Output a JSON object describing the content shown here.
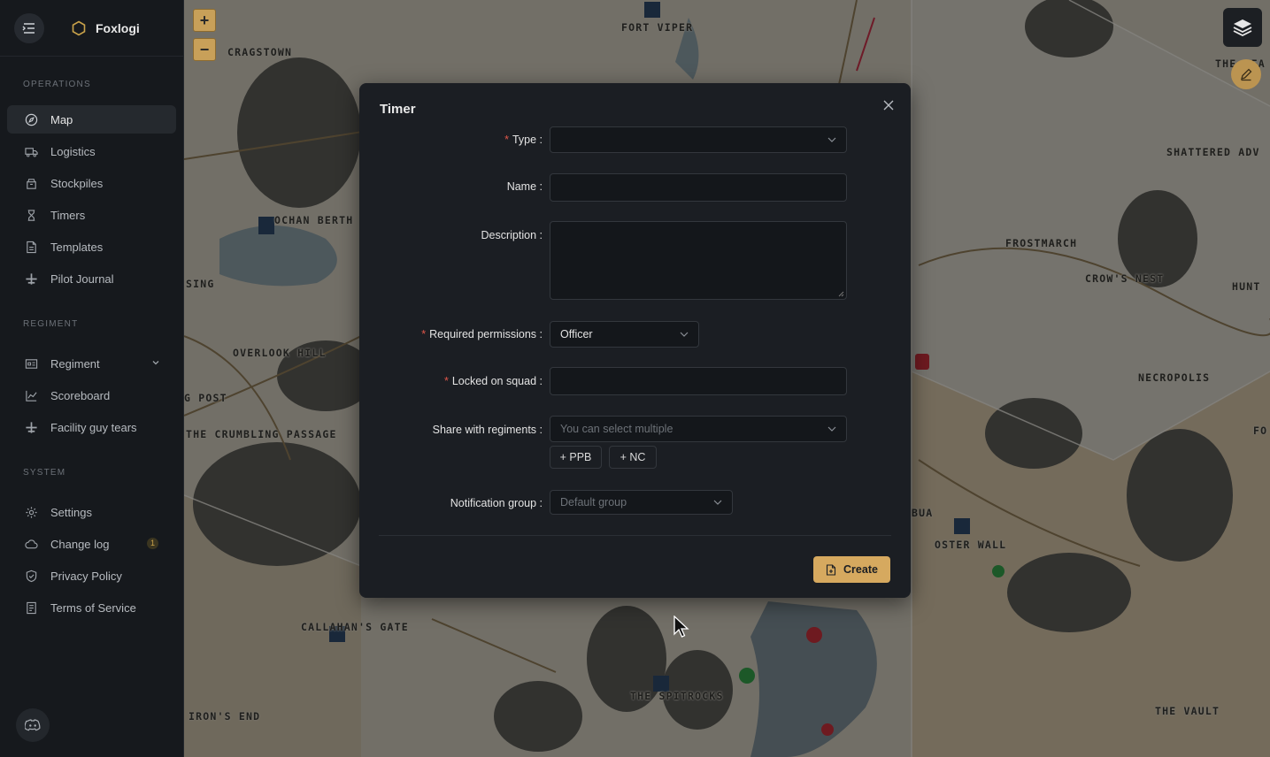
{
  "app": {
    "name": "Foxlogi"
  },
  "sidebar": {
    "sections": [
      {
        "title": "OPERATIONS"
      },
      {
        "title": "REGIMENT"
      },
      {
        "title": "SYSTEM"
      }
    ],
    "items": [
      {
        "label": "Map",
        "icon": "compass-icon"
      },
      {
        "label": "Logistics",
        "icon": "truck-icon"
      },
      {
        "label": "Stockpiles",
        "icon": "box-icon"
      },
      {
        "label": "Timers",
        "icon": "timer-icon"
      },
      {
        "label": "Templates",
        "icon": "file-icon"
      },
      {
        "label": "Pilot Journal",
        "icon": "plane-icon"
      },
      {
        "label": "Regiment",
        "icon": "id-card-icon"
      },
      {
        "label": "Scoreboard",
        "icon": "line-chart-icon"
      },
      {
        "label": "Facility guy tears",
        "icon": "plane-icon"
      },
      {
        "label": "Settings",
        "icon": "gear-icon"
      },
      {
        "label": "Change log",
        "icon": "cloud-icon",
        "badge": "1"
      },
      {
        "label": "Privacy Policy",
        "icon": "shield-icon"
      },
      {
        "label": "Terms of Service",
        "icon": "document-icon"
      }
    ]
  },
  "map": {
    "zoom_in": "+",
    "zoom_out": "−",
    "places": [
      "FORT VIPER",
      "CRAGSTOWN",
      "OCHAN BERTH",
      "SING",
      "OVERLOOK HILL",
      "G POST",
      "THE CRUMBLING PASSAGE",
      "CALLAHAN'S GATE",
      "IRON'S END",
      "THE SPITROCKS",
      "SHATTERED ADV",
      "FROSTMARCH",
      "CROW'S NEST",
      "HUNT",
      "NECROPOLIS",
      "FO",
      "BUA",
      "OSTER WALL",
      "THE VAULT",
      "THE WEA"
    ]
  },
  "modal": {
    "title": "Timer",
    "fields": {
      "type": {
        "label": "Type",
        "value": ""
      },
      "name": {
        "label": "Name",
        "value": ""
      },
      "description": {
        "label": "Description",
        "value": ""
      },
      "permissions": {
        "label": "Required permissions",
        "value": "Officer"
      },
      "squad": {
        "label": "Locked on squad",
        "value": ""
      },
      "share": {
        "label": "Share with regiments",
        "placeholder": "You can select multiple"
      },
      "notification": {
        "label": "Notification group",
        "placeholder": "Default group"
      }
    },
    "quick_add": [
      "+ PPB",
      "+ NC"
    ],
    "create_label": "Create"
  },
  "colors": {
    "accent": "#d6a95f",
    "required": "#e0564a",
    "modal_bg": "#1b1e23",
    "sidebar_bg": "#16191d"
  }
}
